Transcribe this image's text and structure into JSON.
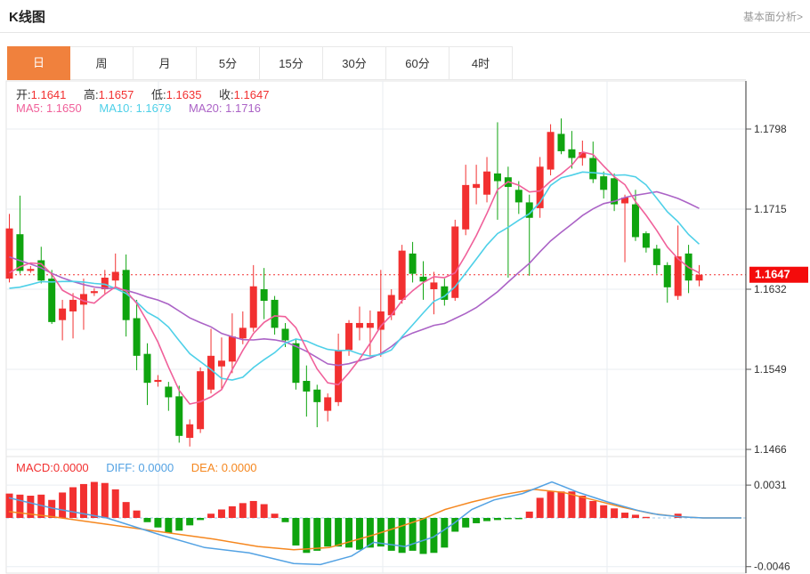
{
  "header": {
    "title": "K线图",
    "link": "基本面分析>"
  },
  "tabs": {
    "items": [
      "日",
      "周",
      "月",
      "5分",
      "15分",
      "30分",
      "60分",
      "4时"
    ],
    "selected_index": 0
  },
  "ohlc": {
    "open_label": "开:",
    "open": "1.1641",
    "high_label": "高:",
    "high": "1.1657",
    "low_label": "低:",
    "low": "1.1635",
    "close_label": "收:",
    "close": "1.1647"
  },
  "ma": {
    "ma5_label": "MA5:",
    "ma5": "1.1650",
    "ma10_label": "MA10:",
    "ma10": "1.1679",
    "ma20_label": "MA20:",
    "ma20": "1.1716"
  },
  "macd_header": {
    "macd_label": "MACD:",
    "macd": "0.0000",
    "diff_label": "DIFF:",
    "diff": "0.0000",
    "dea_label": "DEA:",
    "dea": "0.0000"
  },
  "colors": {
    "up": "#f23030",
    "down": "#0fa40f",
    "ma5": "#f0609a",
    "ma10": "#4ed0e8",
    "ma20": "#ab63c6",
    "diff": "#53a2e3",
    "dea": "#f5871f",
    "tab_accent": "#f0813d",
    "badge": "#f40b0b",
    "grid": "#e9edf2",
    "border": "#e3e3e3",
    "axis": "#555",
    "zero_dash": "#9fcbee",
    "axis_text": "#333",
    "link_text": "#999"
  },
  "chart_data": {
    "type": "candlestick+macd",
    "title": "K线图 daily candlestick with MA5/MA10/MA20 and MACD",
    "price_axis": {
      "ticks": [
        1.1798,
        1.1715,
        1.1632,
        1.1549,
        1.1466
      ],
      "current_price": 1.1647
    },
    "macd_axis": {
      "ticks": [
        0.0031,
        -0.0046
      ]
    },
    "candles": [
      [
        1.1643,
        1.171,
        1.1639,
        1.1695
      ],
      [
        1.1689,
        1.1729,
        1.1648,
        1.1651
      ],
      [
        1.1651,
        1.1656,
        1.1649,
        1.1653
      ],
      [
        1.1662,
        1.1676,
        1.1638,
        1.1641
      ],
      [
        1.1643,
        1.1652,
        1.1596,
        1.1598
      ],
      [
        1.16,
        1.1621,
        1.1579,
        1.1612
      ],
      [
        1.1609,
        1.1628,
        1.1581,
        1.1621
      ],
      [
        1.1616,
        1.1643,
        1.159,
        1.1627
      ],
      [
        1.1628,
        1.1633,
        1.1625,
        1.163
      ],
      [
        1.1632,
        1.1652,
        1.1626,
        1.1644
      ],
      [
        1.1641,
        1.1669,
        1.1632,
        1.165
      ],
      [
        1.1652,
        1.1668,
        1.1583,
        1.16
      ],
      [
        1.1602,
        1.1621,
        1.1548,
        1.1563
      ],
      [
        1.1565,
        1.1576,
        1.1512,
        1.1535
      ],
      [
        1.1536,
        1.1543,
        1.1531,
        1.1538
      ],
      [
        1.1531,
        1.1536,
        1.1506,
        1.152
      ],
      [
        1.1521,
        1.1532,
        1.1473,
        1.148
      ],
      [
        1.1478,
        1.1497,
        1.1469,
        1.1492
      ],
      [
        1.1487,
        1.1551,
        1.1483,
        1.1547
      ],
      [
        1.1528,
        1.1591,
        1.1524,
        1.1563
      ],
      [
        1.1552,
        1.1582,
        1.1528,
        1.1558
      ],
      [
        1.1557,
        1.1607,
        1.1545,
        1.1583
      ],
      [
        1.1581,
        1.1609,
        1.1575,
        1.1592
      ],
      [
        1.1592,
        1.1657,
        1.1588,
        1.1635
      ],
      [
        1.1632,
        1.1654,
        1.1601,
        1.162
      ],
      [
        1.1621,
        1.1625,
        1.1585,
        1.1592
      ],
      [
        1.1591,
        1.1597,
        1.1572,
        1.1579
      ],
      [
        1.1576,
        1.158,
        1.1528,
        1.1535
      ],
      [
        1.1537,
        1.1553,
        1.15,
        1.1526
      ],
      [
        1.1528,
        1.1533,
        1.1489,
        1.1515
      ],
      [
        1.1506,
        1.1524,
        1.1495,
        1.152
      ],
      [
        1.1515,
        1.1586,
        1.1511,
        1.1569
      ],
      [
        1.1569,
        1.16,
        1.1563,
        1.1597
      ],
      [
        1.1592,
        1.1614,
        1.1579,
        1.1597
      ],
      [
        1.1592,
        1.161,
        1.1562,
        1.1597
      ],
      [
        1.159,
        1.1652,
        1.1562,
        1.1609
      ],
      [
        1.1605,
        1.1632,
        1.16,
        1.1626
      ],
      [
        1.1621,
        1.1678,
        1.1617,
        1.1672
      ],
      [
        1.1669,
        1.1681,
        1.1639,
        1.1648
      ],
      [
        1.1645,
        1.1661,
        1.1621,
        1.164
      ],
      [
        1.1632,
        1.165,
        1.1606,
        1.1639
      ],
      [
        1.1635,
        1.1643,
        1.1615,
        1.1621
      ],
      [
        1.1623,
        1.1704,
        1.162,
        1.1697
      ],
      [
        1.1694,
        1.1761,
        1.1688,
        1.174
      ],
      [
        1.1737,
        1.1761,
        1.172,
        1.1741
      ],
      [
        1.173,
        1.1769,
        1.1722,
        1.1754
      ],
      [
        1.1752,
        1.1805,
        1.1704,
        1.1744
      ],
      [
        1.1748,
        1.1759,
        1.1644,
        1.1738
      ],
      [
        1.1735,
        1.1744,
        1.171,
        1.1722
      ],
      [
        1.1722,
        1.173,
        1.1646,
        1.1706
      ],
      [
        1.1716,
        1.1769,
        1.1706,
        1.1759
      ],
      [
        1.1756,
        1.1803,
        1.175,
        1.1795
      ],
      [
        1.1793,
        1.1809,
        1.1772,
        1.1775
      ],
      [
        1.1777,
        1.1796,
        1.1757,
        1.1768
      ],
      [
        1.1768,
        1.1786,
        1.176,
        1.1774
      ],
      [
        1.1768,
        1.1785,
        1.1742,
        1.1746
      ],
      [
        1.1749,
        1.1754,
        1.1726,
        1.1735
      ],
      [
        1.1747,
        1.1752,
        1.1713,
        1.172
      ],
      [
        1.1721,
        1.173,
        1.166,
        1.1727
      ],
      [
        1.172,
        1.1735,
        1.1682,
        1.1686
      ],
      [
        1.169,
        1.1692,
        1.167,
        1.1675
      ],
      [
        1.1674,
        1.1678,
        1.1648,
        1.1657
      ],
      [
        1.1657,
        1.166,
        1.1618,
        1.1634
      ],
      [
        1.1625,
        1.1698,
        1.1621,
        1.1666
      ],
      [
        1.1669,
        1.1678,
        1.1628,
        1.1641
      ],
      [
        1.1641,
        1.1657,
        1.1635,
        1.1647
      ]
    ],
    "ma_seed_closes": [
      1.173,
      1.1725,
      1.1718,
      1.1712,
      1.1705,
      1.1698,
      1.169,
      1.168,
      1.1668,
      1.1655,
      1.164,
      1.1625,
      1.1612,
      1.16,
      1.1608,
      1.162,
      1.1633,
      1.1645,
      1.1652
    ],
    "macd_hist": [
      0.0023,
      0.0022,
      0.0021,
      0.0022,
      0.0017,
      0.0024,
      0.0029,
      0.0032,
      0.0034,
      0.0033,
      0.0027,
      0.0015,
      0.0007,
      -0.0004,
      -0.0009,
      -0.0014,
      -0.0012,
      -0.0007,
      -0.0002,
      0.0004,
      0.0008,
      0.0011,
      0.0014,
      0.0016,
      0.0013,
      0.0004,
      -0.0004,
      -0.0026,
      -0.0033,
      -0.0031,
      -0.0027,
      -0.0027,
      -0.0028,
      -0.003,
      -0.0028,
      -0.0027,
      -0.0031,
      -0.0033,
      -0.0031,
      -0.0034,
      -0.0033,
      -0.0028,
      -0.0013,
      -0.0009,
      -0.0005,
      -0.0003,
      -0.0002,
      -0.0001,
      -0.0001,
      0.0006,
      0.0019,
      0.0025,
      0.0025,
      0.0025,
      0.0021,
      0.0016,
      0.0012,
      0.0009,
      0.0005,
      0.0003,
      0.0001,
      0.0,
      0.0,
      0.0004,
      0.0,
      0.0
    ],
    "diff_line": [
      [
        10,
        0.0019
      ],
      [
        60,
        0.0009
      ],
      [
        120,
        0.0
      ],
      [
        180,
        -0.0016
      ],
      [
        230,
        -0.0028
      ],
      [
        280,
        -0.0033
      ],
      [
        330,
        -0.0043
      ],
      [
        360,
        -0.0044
      ],
      [
        395,
        -0.0036
      ],
      [
        420,
        -0.0023
      ],
      [
        455,
        -0.0027
      ],
      [
        487,
        -0.0018
      ],
      [
        510,
        -0.0005
      ],
      [
        530,
        0.0008
      ],
      [
        555,
        0.0017
      ],
      [
        587,
        0.0023
      ],
      [
        605,
        0.0029
      ],
      [
        620,
        0.0034
      ],
      [
        650,
        0.0024
      ],
      [
        683,
        0.0015
      ],
      [
        717,
        0.0007
      ],
      [
        740,
        0.0003
      ],
      [
        765,
        0.0001
      ],
      [
        790,
        0.0
      ],
      [
        833,
        0.0
      ]
    ],
    "dea_line": [
      [
        10,
        0.0006
      ],
      [
        60,
        0.0001
      ],
      [
        120,
        -0.0006
      ],
      [
        180,
        -0.0013
      ],
      [
        240,
        -0.002
      ],
      [
        290,
        -0.0027
      ],
      [
        330,
        -0.003
      ],
      [
        370,
        -0.0028
      ],
      [
        420,
        -0.0016
      ],
      [
        450,
        -0.0008
      ],
      [
        475,
        -0.0001
      ],
      [
        500,
        0.0008
      ],
      [
        530,
        0.0015
      ],
      [
        565,
        0.0022
      ],
      [
        600,
        0.0027
      ],
      [
        633,
        0.0024
      ],
      [
        667,
        0.0017
      ],
      [
        700,
        0.001
      ],
      [
        733,
        0.0004
      ],
      [
        765,
        0.0001
      ],
      [
        790,
        0.0
      ],
      [
        833,
        0.0
      ]
    ]
  }
}
